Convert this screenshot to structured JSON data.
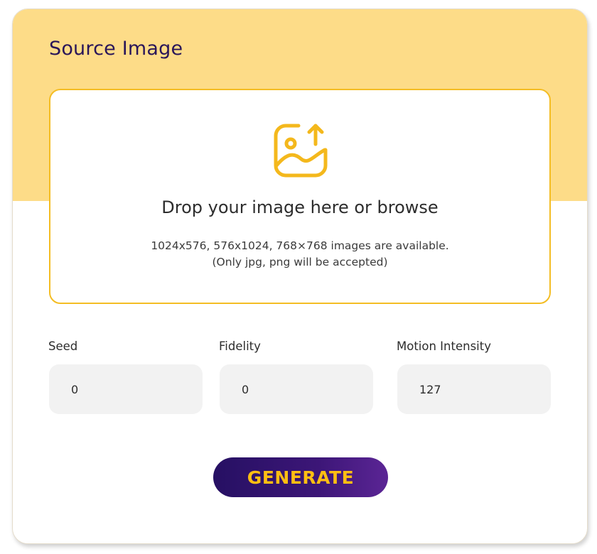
{
  "panel": {
    "title": "Source Image"
  },
  "dropzone": {
    "icon": "image-upload-icon",
    "heading": "Drop your image here or browse",
    "note_line1": "1024x576, 576x1024, 768×768 images are available.",
    "note_line2": "(Only jpg, png will be accepted)"
  },
  "fields": [
    {
      "label": "Seed",
      "value": "0"
    },
    {
      "label": "Fidelity",
      "value": "0"
    },
    {
      "label": "Motion Intensity",
      "value": "127"
    }
  ],
  "actions": {
    "generate_label": "GENERATE"
  },
  "colors": {
    "header_bg": "#fddc88",
    "accent": "#f4bd24",
    "title_text": "#2a1659",
    "button_bg": "#2e1268",
    "button_text": "#ffbf12",
    "field_bg": "#f2f2f2"
  }
}
